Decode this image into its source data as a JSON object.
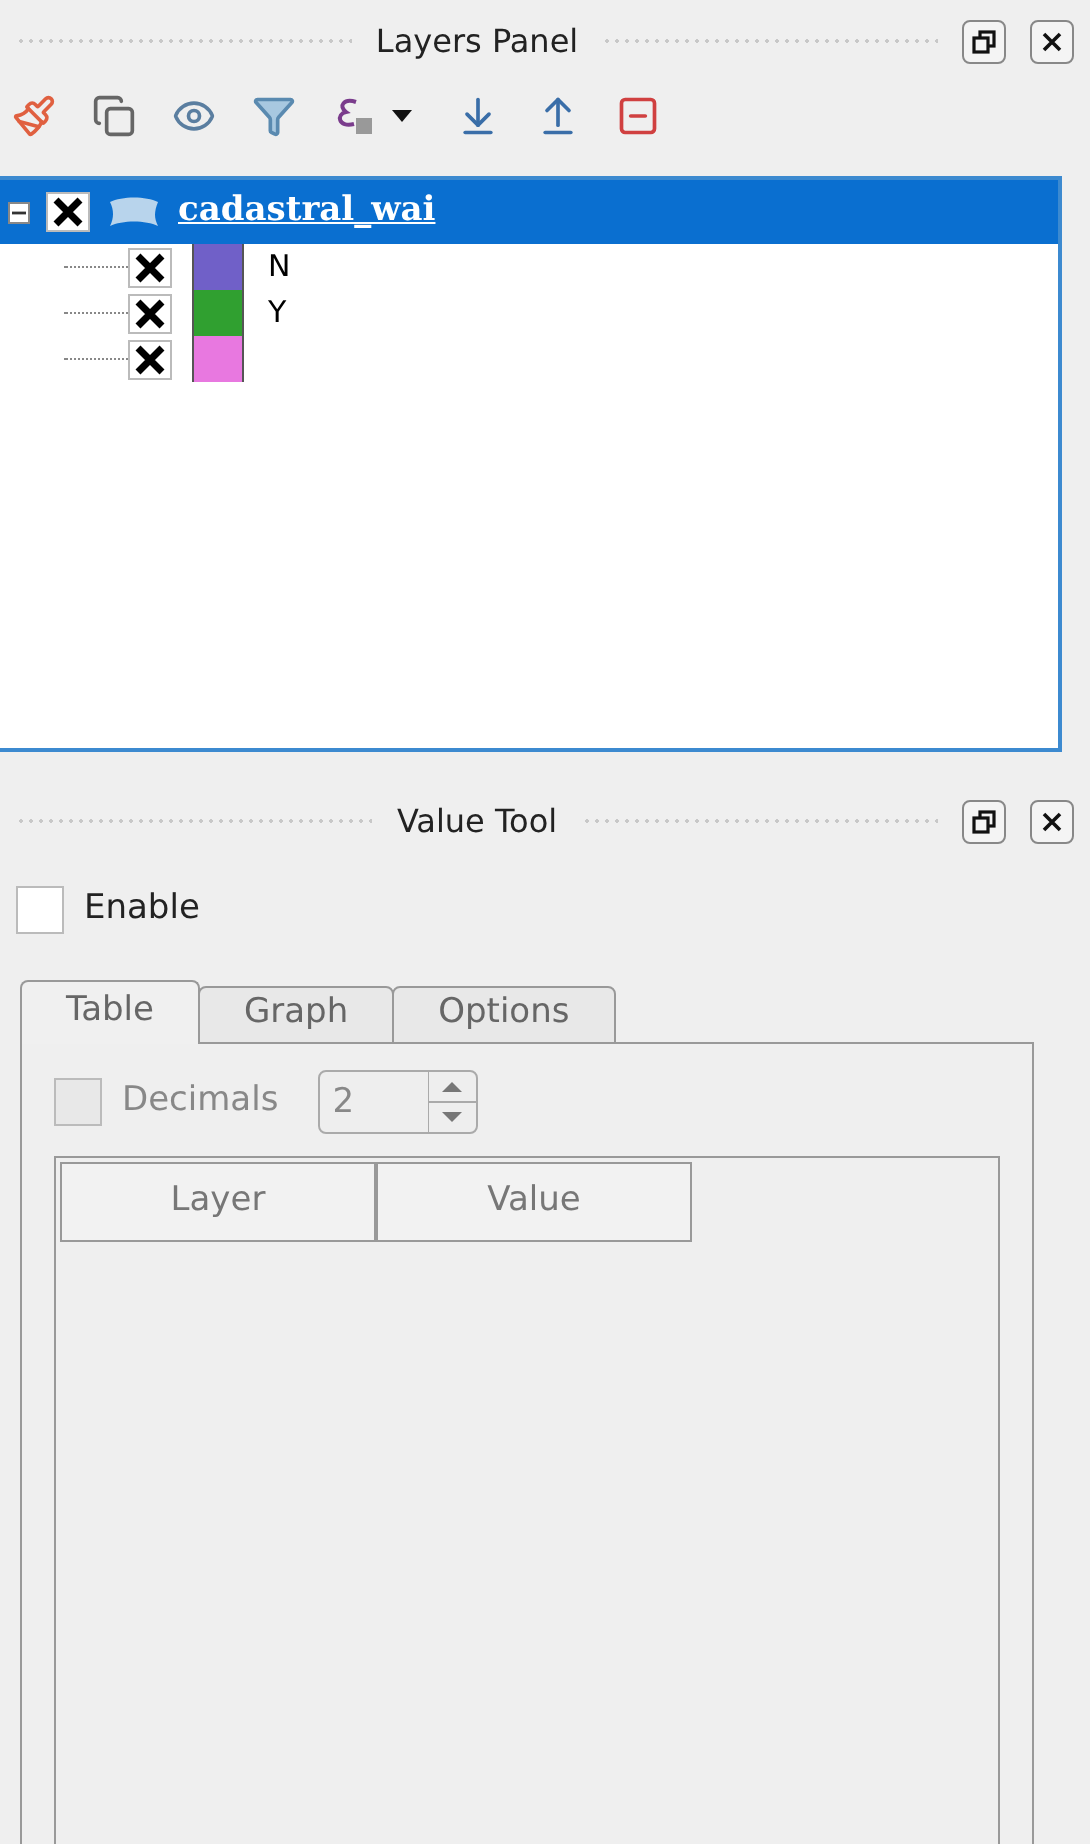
{
  "layers_panel": {
    "title": "Layers Panel",
    "tree": [
      {
        "label": "cadastral_wai",
        "checked": true,
        "expanded": true,
        "selected": true,
        "children": [
          {
            "label": "N",
            "checked": true,
            "color": "#7060c8"
          },
          {
            "label": "Y",
            "checked": true,
            "color": "#30a030"
          },
          {
            "checked": true,
            "color": "#e878e0"
          }
        ]
      }
    ]
  },
  "value_tool": {
    "title": "Value Tool",
    "enable": {
      "label": "Enable",
      "checked": false
    },
    "tabs": [
      {
        "label": "Table",
        "selected": true
      },
      {
        "label": "Graph",
        "selected": false
      },
      {
        "label": "Options",
        "selected": false
      }
    ],
    "decimals": {
      "label": "Decimals",
      "checked": false,
      "value": "2"
    },
    "table": {
      "columns": [
        "Layer",
        "Value"
      ]
    }
  }
}
